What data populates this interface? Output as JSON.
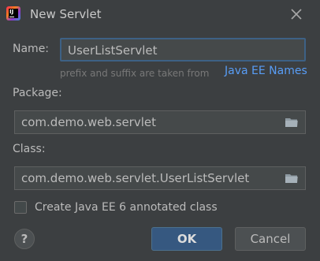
{
  "window": {
    "title": "New Servlet",
    "app_icon_text": "IJ"
  },
  "form": {
    "name_label": "Name:",
    "name_value": "UserListServlet",
    "name_hint": "prefix and suffix are taken from",
    "name_hint_link": "Java EE Names",
    "package_label": "Package:",
    "package_value": "com.demo.web.servlet",
    "class_label": "Class:",
    "class_value": "com.demo.web.servlet.UserListServlet",
    "annotated_checkbox_label": "Create Java EE 6 annotated class",
    "annotated_checked": false
  },
  "buttons": {
    "help": "?",
    "ok": "OK",
    "cancel": "Cancel"
  },
  "colors": {
    "background": "#3c3f41",
    "field_background": "#45494a",
    "focus_border": "#3d6185",
    "link": "#589df6",
    "ok_button": "#365880"
  }
}
